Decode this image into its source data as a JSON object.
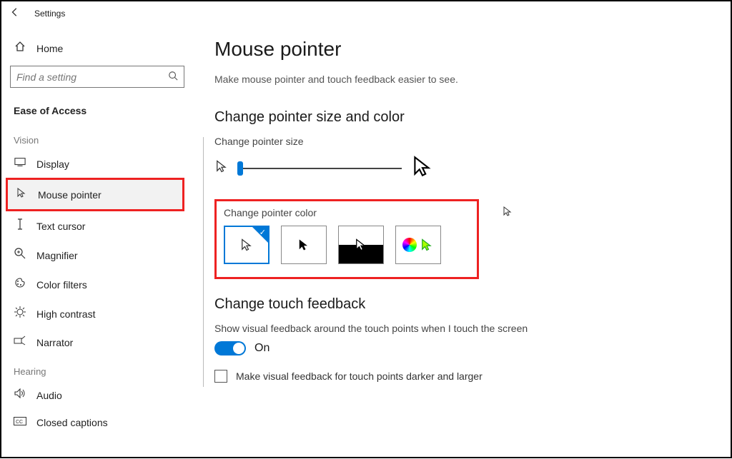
{
  "titlebar": {
    "title": "Settings"
  },
  "sidebar": {
    "home": "Home",
    "search_placeholder": "Find a setting",
    "category": "Ease of Access",
    "groups": [
      {
        "label": "Vision",
        "items": [
          {
            "id": "display",
            "label": "Display",
            "icon": "monitor"
          },
          {
            "id": "mouse-pointer",
            "label": "Mouse pointer",
            "icon": "mouse-pointer",
            "highlighted": true
          },
          {
            "id": "text-cursor",
            "label": "Text cursor",
            "icon": "text-cursor"
          },
          {
            "id": "magnifier",
            "label": "Magnifier",
            "icon": "magnifier"
          },
          {
            "id": "color-filters",
            "label": "Color filters",
            "icon": "palette"
          },
          {
            "id": "high-contrast",
            "label": "High contrast",
            "icon": "contrast"
          },
          {
            "id": "narrator",
            "label": "Narrator",
            "icon": "narrator"
          }
        ]
      },
      {
        "label": "Hearing",
        "items": [
          {
            "id": "audio",
            "label": "Audio",
            "icon": "audio"
          },
          {
            "id": "closed-captions",
            "label": "Closed captions",
            "icon": "cc"
          }
        ]
      }
    ]
  },
  "main": {
    "title": "Mouse pointer",
    "subtitle": "Make mouse pointer and touch feedback easier to see.",
    "section_size_color": "Change pointer size and color",
    "label_size": "Change pointer size",
    "label_color": "Change pointer color",
    "color_options": [
      {
        "id": "white",
        "selected": true
      },
      {
        "id": "black"
      },
      {
        "id": "inverted"
      },
      {
        "id": "custom"
      }
    ],
    "section_touch": "Change touch feedback",
    "touch_description": "Show visual feedback around the touch points when I touch the screen",
    "toggle_on_label": "On",
    "toggle_on": true,
    "checkbox_label": "Make visual feedback for touch points darker and larger",
    "checkbox_checked": false
  }
}
